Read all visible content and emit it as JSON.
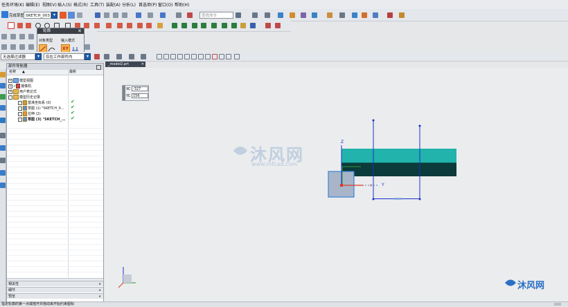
{
  "menubar": {
    "items": [
      {
        "label": "任务环境(K)"
      },
      {
        "label": "编辑(E)"
      },
      {
        "label": "视图(V)"
      },
      {
        "label": "插入(S)"
      },
      {
        "label": "格式(R)"
      },
      {
        "label": "工具(T)"
      },
      {
        "label": "装配(A)"
      },
      {
        "label": "分析(L)"
      },
      {
        "label": "首选项(P)"
      },
      {
        "label": "窗口(O)"
      },
      {
        "label": "帮助(H)"
      }
    ],
    "search_placeholder": "查找命令"
  },
  "toolbar": {
    "finish_sketch_label": "完成草图",
    "sketch_name": "SKETCH_003"
  },
  "filter_bar": {
    "type_filter": "无选择过滤器",
    "scope_filter": "仅在工作部件内"
  },
  "popup_dialog": {
    "title": "轮廓",
    "object_type_label": "对象类型",
    "input_mode_label": "输入模式",
    "xy_label": "XY"
  },
  "file_tab": {
    "label": "_model2.prt"
  },
  "navigator": {
    "title": "部件导航器",
    "col_name": "名称",
    "col_latest": "最新",
    "items": [
      {
        "label": "模型视图",
        "indent": 0,
        "check": ""
      },
      {
        "label": "摄像机",
        "indent": 0,
        "check": ""
      },
      {
        "label": "用户表达式",
        "indent": 0,
        "check": ""
      },
      {
        "label": "模型历史记录",
        "indent": 0,
        "check": ""
      },
      {
        "label": "基准坐标系 (0)",
        "indent": 1,
        "check": "✔"
      },
      {
        "label": "草图 (1) \"SKETCH_0...",
        "indent": 1,
        "check": "✔"
      },
      {
        "label": "拉伸 (2)",
        "indent": 1,
        "check": "✔"
      },
      {
        "label": "草图 (3) \"SKETCH_...",
        "indent": 1,
        "check": "✔"
      }
    ],
    "panels": [
      {
        "label": "相关性"
      },
      {
        "label": "细节"
      },
      {
        "label": "预览"
      }
    ]
  },
  "coordinate_tip": {
    "xc_label": "XC",
    "xc_value": "-327",
    "yc_label": "YC",
    "yc_value": "156"
  },
  "canvas": {
    "axis_z": "Z",
    "axis_y": "Y",
    "watermark_cn": "沐风网",
    "watermark_url": "www.mfcad.com",
    "corner_logo": "沐风网"
  },
  "status": {
    "prompt": "指定轮廓的第一点或拖开并拖动来开始约束图标"
  },
  "colors": {
    "solid_top": "#21b3ac",
    "solid_bottom": "#0b3b3a",
    "sketch_line": "#1f2fc9",
    "axis_red": "#d93a2a",
    "axis_green": "#2e9a3a"
  }
}
